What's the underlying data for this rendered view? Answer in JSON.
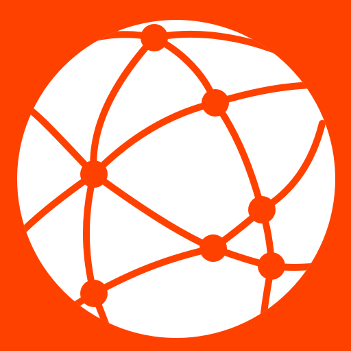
{
  "icon": {
    "name": "network-globe-icon",
    "colors": {
      "background": "#FF4100",
      "globe": "#FFFFFF",
      "network": "#FF4100"
    }
  }
}
